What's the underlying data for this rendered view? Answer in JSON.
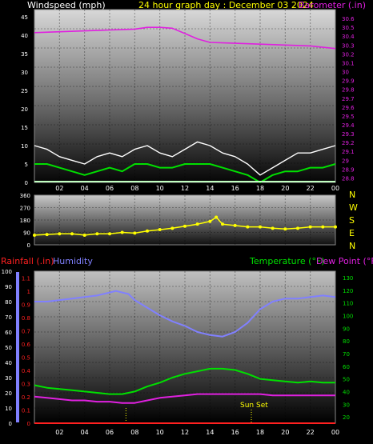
{
  "chart_data": [
    {
      "type": "line",
      "panel": "wind-barometer",
      "title": "24 hour graph day : December 03 2024",
      "ylabel_left": "Windspeed (mph)",
      "ylabel_right": "Barometer (.in)",
      "x_ticks": [
        "02",
        "04",
        "06",
        "08",
        "10",
        "12",
        "14",
        "16",
        "18",
        "20",
        "22",
        "00"
      ],
      "y_left_ticks": [
        "0",
        "5",
        "10",
        "15",
        "20",
        "25",
        "30",
        "35",
        "40",
        "45"
      ],
      "y_right_ticks": [
        "28.8",
        "28.9",
        "29",
        "29.1",
        "29.2",
        "29.3",
        "29.4",
        "29.5",
        "29.6",
        "29.7",
        "29.8",
        "29.9",
        "30",
        "30.1",
        "30.2",
        "30.3",
        "30.4",
        "30.5",
        "30.6"
      ],
      "ylim_left": [
        0,
        47
      ],
      "ylim_right": [
        28.75,
        30.7
      ],
      "xlim": [
        0,
        24
      ],
      "grid": true,
      "colors": {
        "barometer": "#e020e0",
        "wind_gust": "#ffffff",
        "wind_avg": "#00e000",
        "wind_calm": "#c0ffc0",
        "title": "#ffff00"
      },
      "series": [
        {
          "name": "Barometer",
          "axis": "right",
          "color": "#e020e0",
          "x": [
            0,
            2,
            4,
            6,
            8,
            9,
            10,
            11,
            12,
            13,
            14,
            16,
            18,
            20,
            22,
            24
          ],
          "values": [
            30.44,
            30.45,
            30.46,
            30.47,
            30.48,
            30.5,
            30.5,
            30.49,
            30.43,
            30.37,
            30.33,
            30.32,
            30.31,
            30.3,
            30.29,
            30.26
          ]
        },
        {
          "name": "Wind gust",
          "axis": "left",
          "color": "#ffffff",
          "x": [
            0,
            1,
            2,
            3,
            4,
            5,
            6,
            7,
            8,
            9,
            10,
            11,
            12,
            13,
            14,
            15,
            16,
            17,
            18,
            19,
            20,
            21,
            22,
            23,
            24
          ],
          "values": [
            10,
            9,
            7,
            6,
            5,
            7,
            8,
            7,
            9,
            10,
            8,
            7,
            9,
            11,
            10,
            8,
            7,
            5,
            2,
            4,
            6,
            8,
            8,
            9,
            10
          ]
        },
        {
          "name": "Wind average",
          "axis": "left",
          "color": "#00e000",
          "x": [
            0,
            1,
            2,
            3,
            4,
            5,
            6,
            7,
            8,
            9,
            10,
            11,
            12,
            13,
            14,
            15,
            16,
            17,
            18,
            19,
            20,
            21,
            22,
            23,
            24
          ],
          "values": [
            5,
            5,
            4,
            3,
            2,
            3,
            4,
            3,
            5,
            5,
            4,
            4,
            5,
            5,
            5,
            4,
            3,
            2,
            0,
            2,
            3,
            3,
            4,
            4,
            5
          ]
        }
      ]
    },
    {
      "type": "scatter",
      "panel": "wind-direction",
      "ylabel_right": [
        "N",
        "W",
        "S",
        "E",
        "N"
      ],
      "y_ticks": [
        "0",
        "90",
        "180",
        "270",
        "360"
      ],
      "ylim": [
        0,
        360
      ],
      "xlim": [
        0,
        24
      ],
      "grid": true,
      "colors": {
        "direction": "#ffff00"
      },
      "series": [
        {
          "name": "Wind direction",
          "color": "#ffff00",
          "x": [
            0,
            1,
            2,
            3,
            4,
            5,
            6,
            7,
            8,
            9,
            10,
            11,
            12,
            13,
            14,
            14.5,
            15,
            16,
            17,
            18,
            19,
            20,
            21,
            22,
            23,
            24
          ],
          "values": [
            70,
            75,
            80,
            80,
            70,
            80,
            80,
            90,
            85,
            100,
            110,
            120,
            135,
            150,
            170,
            200,
            150,
            140,
            130,
            130,
            120,
            115,
            120,
            130,
            130,
            130
          ]
        }
      ]
    },
    {
      "type": "line",
      "panel": "temp-humidity-rain",
      "legend": [
        "Rainfall (.in)",
        "Humidity",
        "Temperature (°F)",
        "Dew Point (°F)"
      ],
      "sunset_label": "Sun Set",
      "x_ticks": [
        "02",
        "04",
        "06",
        "08",
        "10",
        "12",
        "14",
        "16",
        "18",
        "20",
        "22",
        "00"
      ],
      "humidity_ticks": [
        "0",
        "10",
        "20",
        "30",
        "40",
        "50",
        "60",
        "70",
        "80",
        "90",
        "100"
      ],
      "rain_ticks": [
        "0",
        "0.1",
        "0.2",
        "0.3",
        "0.4",
        "0.5",
        "0.6",
        "0.7",
        "0.8",
        "0.9",
        "1",
        "1.1"
      ],
      "temp_ticks": [
        "20",
        "30",
        "40",
        "50",
        "60",
        "70",
        "80",
        "90",
        "100",
        "110",
        "120",
        "130"
      ],
      "ylim_humidity": [
        0,
        100
      ],
      "ylim_rain": [
        0,
        1.15
      ],
      "ylim_temp": [
        15,
        135
      ],
      "xlim": [
        0,
        24
      ],
      "grid": true,
      "colors": {
        "rain": "#ff2020",
        "humidity": "#8080ff",
        "temperature": "#00e000",
        "dewpoint": "#e020e0",
        "sunrise": "#ffff00"
      },
      "series": [
        {
          "name": "Humidity",
          "axis": "humidity",
          "color": "#8080ff",
          "x": [
            0,
            1,
            2,
            3,
            4,
            5,
            6,
            6.5,
            7,
            7.5,
            8,
            9,
            10,
            11,
            12,
            13,
            14,
            15,
            16,
            17,
            18,
            19,
            20,
            21,
            22,
            23,
            24
          ],
          "values": [
            80,
            80,
            81,
            82,
            83,
            84,
            86,
            87,
            86,
            85,
            81,
            76,
            71,
            67,
            64,
            60,
            58,
            57,
            60,
            66,
            75,
            80,
            82,
            82,
            83,
            84,
            83
          ]
        },
        {
          "name": "Temperature (°F)",
          "axis": "temp",
          "color": "#00e000",
          "x": [
            0,
            1,
            2,
            3,
            4,
            5,
            6,
            7,
            8,
            9,
            10,
            11,
            12,
            13,
            14,
            15,
            16,
            17,
            18,
            19,
            20,
            21,
            22,
            23,
            24
          ],
          "values": [
            45,
            43,
            42,
            41,
            40,
            39,
            38,
            38,
            40,
            44,
            47,
            51,
            54,
            56,
            58,
            58,
            57,
            54,
            50,
            49,
            48,
            47,
            48,
            47,
            47
          ]
        },
        {
          "name": "Dew Point (°F)",
          "axis": "temp",
          "color": "#e020e0",
          "x": [
            0,
            1,
            2,
            3,
            4,
            5,
            6,
            7,
            8,
            9,
            10,
            11,
            12,
            13,
            14,
            15,
            16,
            17,
            18,
            19,
            20,
            21,
            22,
            23,
            24
          ],
          "values": [
            36,
            35,
            34,
            33,
            33,
            32,
            32,
            31,
            31,
            33,
            35,
            36,
            37,
            38,
            38,
            38,
            38,
            38,
            38,
            37,
            37,
            37,
            37,
            37,
            37
          ]
        },
        {
          "name": "Rainfall (.in)",
          "axis": "rain",
          "color": "#ff2020",
          "x": [
            0,
            24
          ],
          "values": [
            0,
            0
          ]
        }
      ],
      "markers": {
        "sunrise_x": 7.3,
        "sunset_x": 17.3
      }
    }
  ]
}
